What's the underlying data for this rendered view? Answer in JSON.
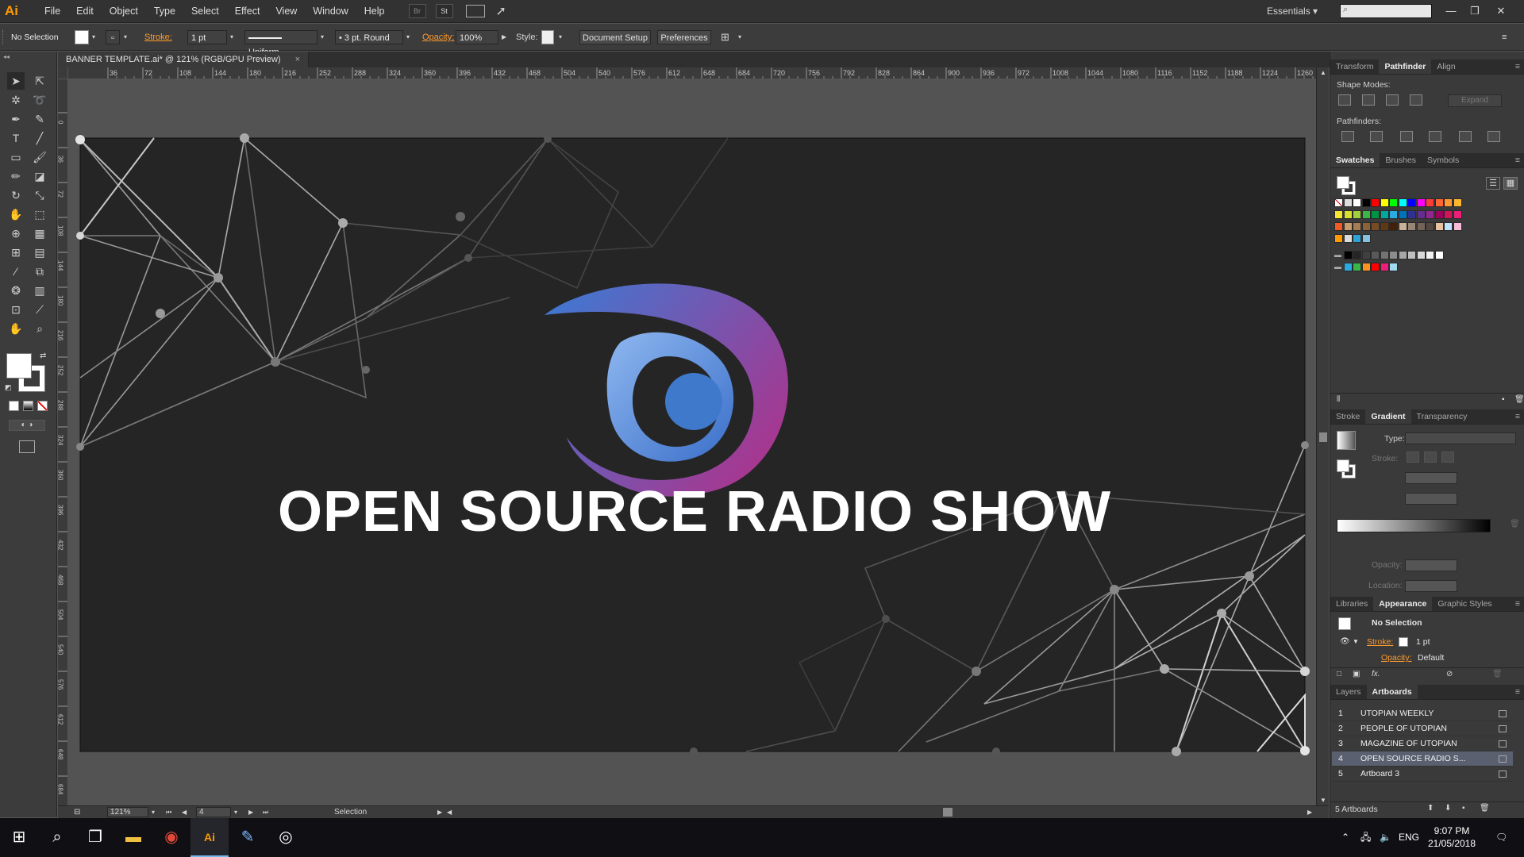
{
  "menu": {
    "logo": "Ai",
    "items": [
      "File",
      "Edit",
      "Object",
      "Type",
      "Select",
      "Effect",
      "View",
      "Window",
      "Help"
    ],
    "bridge_label": "Br",
    "stock_label": "St",
    "workspace": "Essentials"
  },
  "control": {
    "selection": "No Selection",
    "stroke_label": "Stroke:",
    "stroke_weight": "1 pt",
    "stroke_profile": "Uniform",
    "brush": "3 pt. Round",
    "opacity_label": "Opacity:",
    "opacity": "100%",
    "style_label": "Style:",
    "document_setup": "Document Setup",
    "preferences": "Preferences"
  },
  "document": {
    "tab_title": "BANNER TEMPLATE.ai* @ 121% (RGB/GPU Preview)",
    "close": "×",
    "ruler_h": [
      "36",
      "72",
      "108",
      "144",
      "180",
      "216",
      "252",
      "288",
      "324",
      "360",
      "396",
      "432",
      "468",
      "504",
      "540",
      "576",
      "612",
      "648",
      "684",
      "720",
      "756",
      "792",
      "828",
      "864",
      "900",
      "936",
      "972",
      "1008",
      "1044",
      "1080",
      "1116",
      "1152",
      "1188",
      "1224",
      "1260"
    ],
    "ruler_v": [
      "0",
      "36",
      "72",
      "108",
      "144",
      "180",
      "216",
      "252",
      "288",
      "324",
      "360",
      "396",
      "432",
      "468",
      "504",
      "540",
      "576",
      "612",
      "648",
      "684"
    ],
    "headline": "OPEN SOURCE RADIO SHOW",
    "gradient_start": "#3a7bd5",
    "gradient_end": "#a8368f"
  },
  "status": {
    "zoom": "121%",
    "artboard_num": "4",
    "mode": "Selection"
  },
  "panels": {
    "top_tabs": [
      "Transform",
      "Pathfinder",
      "Align"
    ],
    "shape_modes_label": "Shape Modes:",
    "pathfinders_label": "Pathfinders:",
    "expand": "Expand",
    "swatch_tabs": [
      "Swatches",
      "Brushes",
      "Symbols"
    ],
    "gradient_tabs": [
      "Stroke",
      "Gradient",
      "Transparency"
    ],
    "type_label": "Type:",
    "stroke_label": "Stroke:",
    "opacity_label": "Opacity:",
    "location_label": "Location:",
    "appearance_tabs": [
      "Libraries",
      "Appearance",
      "Graphic Styles"
    ],
    "appearance_selection": "No Selection",
    "appearance_stroke": "Stroke:",
    "appearance_stroke_val": "1 pt",
    "appearance_opacity": "Opacity:",
    "appearance_opacity_val": "Default",
    "layer_tabs": [
      "Layers",
      "Artboards"
    ],
    "artboards": [
      {
        "num": "1",
        "name": "UTOPIAN WEEKLY"
      },
      {
        "num": "2",
        "name": "PEOPLE OF UTOPIAN"
      },
      {
        "num": "3",
        "name": "MAGAZINE OF UTOPIAN"
      },
      {
        "num": "4",
        "name": "OPEN SOURCE RADIO S..."
      },
      {
        "num": "5",
        "name": "Artboard 3"
      }
    ],
    "artboard_count": "5 Artboards"
  },
  "taskbar": {
    "lang": "ENG",
    "time": "9:07 PM",
    "date": "21/05/2018"
  }
}
